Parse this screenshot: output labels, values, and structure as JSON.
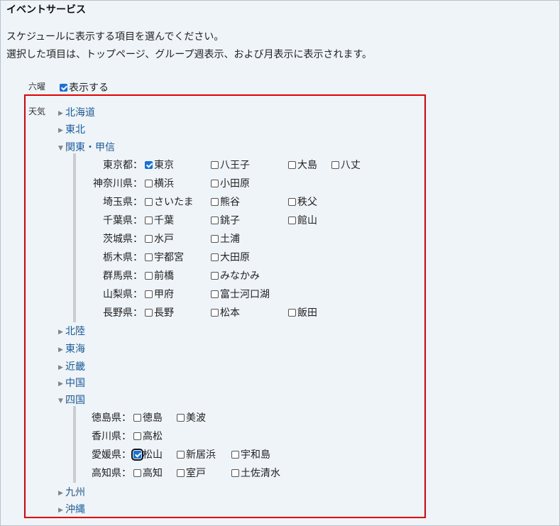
{
  "title": "イベントサービス",
  "description": [
    "スケジュールに表示する項目を選んでください。",
    "選択した項目は、トップページ、グループ週表示、および月表示に表示されます。"
  ],
  "rokuyo": {
    "label": "六曜",
    "option": "表示する",
    "checked": true
  },
  "weather": {
    "label": "天気",
    "regions": [
      {
        "name": "北海道",
        "expanded": false
      },
      {
        "name": "東北",
        "expanded": false
      },
      {
        "name": "関東・甲信",
        "expanded": true,
        "prefs": [
          {
            "label": "東京都：",
            "cities": [
              {
                "name": "東京",
                "checked": true
              },
              {
                "name": "八王子",
                "checked": false
              },
              {
                "name": "大島",
                "checked": false
              },
              {
                "name": "八丈",
                "checked": false
              }
            ]
          },
          {
            "label": "神奈川県：",
            "cities": [
              {
                "name": "横浜",
                "checked": false
              },
              {
                "name": "小田原",
                "checked": false
              }
            ]
          },
          {
            "label": "埼玉県：",
            "cities": [
              {
                "name": "さいたま",
                "checked": false
              },
              {
                "name": "熊谷",
                "checked": false
              },
              {
                "name": "秩父",
                "checked": false
              }
            ]
          },
          {
            "label": "千葉県：",
            "cities": [
              {
                "name": "千葉",
                "checked": false
              },
              {
                "name": "銚子",
                "checked": false
              },
              {
                "name": "館山",
                "checked": false
              }
            ]
          },
          {
            "label": "茨城県：",
            "cities": [
              {
                "name": "水戸",
                "checked": false
              },
              {
                "name": "土浦",
                "checked": false
              }
            ]
          },
          {
            "label": "栃木県：",
            "cities": [
              {
                "name": "宇都宮",
                "checked": false
              },
              {
                "name": "大田原",
                "checked": false
              }
            ]
          },
          {
            "label": "群馬県：",
            "cities": [
              {
                "name": "前橋",
                "checked": false
              },
              {
                "name": "みなかみ",
                "checked": false
              }
            ]
          },
          {
            "label": "山梨県：",
            "cities": [
              {
                "name": "甲府",
                "checked": false
              },
              {
                "name": "富士河口湖",
                "checked": false
              }
            ]
          },
          {
            "label": "長野県：",
            "cities": [
              {
                "name": "長野",
                "checked": false
              },
              {
                "name": "松本",
                "checked": false
              },
              {
                "name": "飯田",
                "checked": false
              }
            ]
          }
        ]
      },
      {
        "name": "北陸",
        "expanded": false
      },
      {
        "name": "東海",
        "expanded": false
      },
      {
        "name": "近畿",
        "expanded": false
      },
      {
        "name": "中国",
        "expanded": false
      },
      {
        "name": "四国",
        "expanded": true,
        "prefs": [
          {
            "label": "徳島県：",
            "cities": [
              {
                "name": "徳島",
                "checked": false
              },
              {
                "name": "美波",
                "checked": false
              }
            ]
          },
          {
            "label": "香川県：",
            "cities": [
              {
                "name": "高松",
                "checked": false
              }
            ]
          },
          {
            "label": "愛媛県：",
            "cities": [
              {
                "name": "松山",
                "checked": true,
                "focused": true
              },
              {
                "name": "新居浜",
                "checked": false
              },
              {
                "name": "宇和島",
                "checked": false
              }
            ]
          },
          {
            "label": "高知県：",
            "cities": [
              {
                "name": "高知",
                "checked": false
              },
              {
                "name": "室戸",
                "checked": false
              },
              {
                "name": "土佐清水",
                "checked": false
              }
            ]
          }
        ]
      },
      {
        "name": "九州",
        "expanded": false
      },
      {
        "name": "沖縄",
        "expanded": false
      }
    ]
  },
  "colors": {
    "link": "#1a5a9e",
    "highlight_border": "#e00000",
    "checkbox_checked": "#1a6fd8"
  },
  "icons": {
    "collapsed": "triangle-right-icon",
    "expanded": "triangle-down-icon"
  }
}
